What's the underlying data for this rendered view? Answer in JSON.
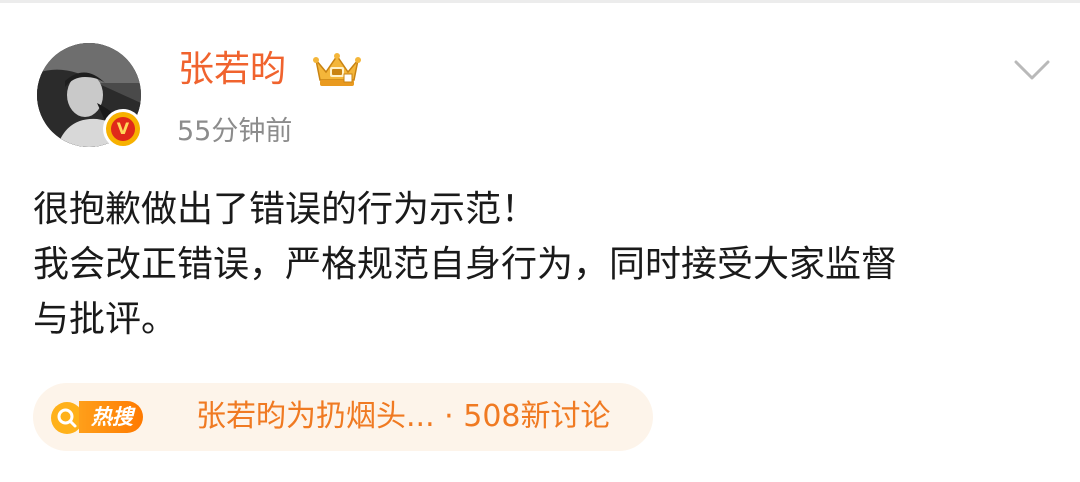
{
  "post": {
    "author": {
      "name": "张若昀",
      "verified_mark": "V",
      "avatar_icon": "avatar-photo",
      "badge_icon": "crown-badge-icon"
    },
    "timestamp": "55分钟前",
    "menu_icon": "chevron-down-icon",
    "content_lines": [
      "很抱歉做出了错误的行为示范！",
      "我会改正错误，严格规范自身行为，同时接受大家监督",
      "与批评。"
    ]
  },
  "hot_search": {
    "tag": "热搜",
    "icon": "search-icon",
    "topic": "张若昀为扔烟头...",
    "separator": "·",
    "discussion_count": "508新讨论"
  },
  "colors": {
    "username": "#f0632e",
    "timestamp": "#8c8c8c",
    "body_text": "#1a1a1a",
    "hot_search_bg": "#fdf4ea",
    "hot_search_text": "#f07a22",
    "hot_tag": "#ff8a00",
    "verified_red": "#e0291a",
    "verified_gold": "#f7b100"
  }
}
